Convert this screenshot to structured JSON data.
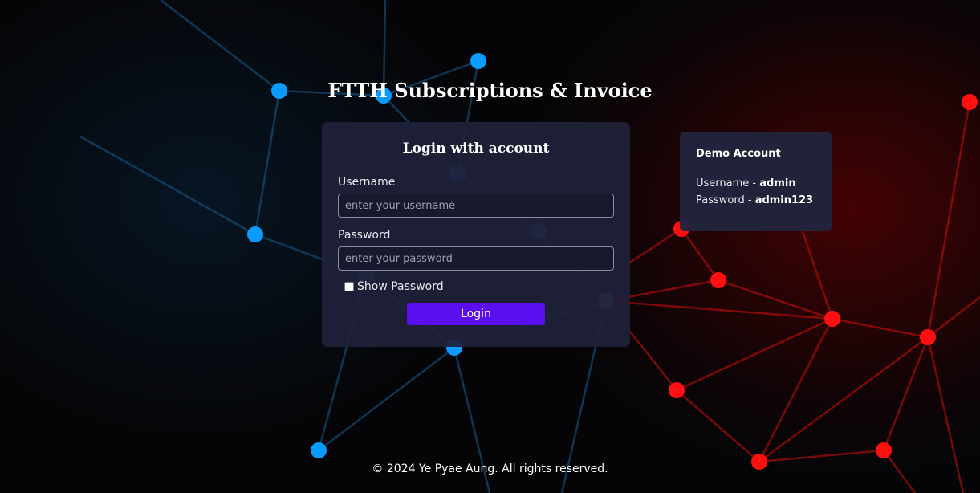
{
  "page": {
    "title": "FTTH Subscriptions & Invoice",
    "footer": "© 2024 Ye Pyae Aung. All rights reserved."
  },
  "login": {
    "heading": "Login with account",
    "username_label": "Username",
    "username_placeholder": "enter your username",
    "username_value": "",
    "password_label": "Password",
    "password_placeholder": "enter your password",
    "password_value": "",
    "show_password_label": "Show Password",
    "show_password_checked": false,
    "submit_label": "Login"
  },
  "demo": {
    "title": "Demo Account",
    "username_prefix": "Username - ",
    "username": "admin",
    "password_prefix": "Password - ",
    "password": "admin123"
  },
  "colors": {
    "accent_button": "#5a10ee",
    "card_bg": "#20223a",
    "node_blue": "#0a9bff",
    "node_red": "#ff1010"
  }
}
